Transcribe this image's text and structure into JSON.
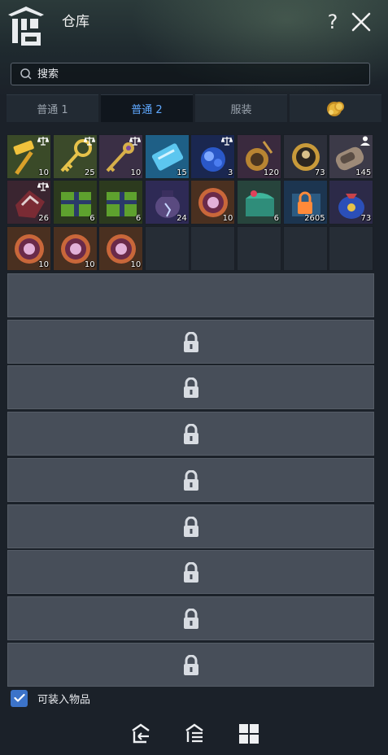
{
  "window": {
    "title": "仓库",
    "help_label": "?",
    "icons": {
      "logo": "warehouse-icon",
      "close": "close-icon"
    }
  },
  "search": {
    "placeholder": "搜索",
    "value": ""
  },
  "tabs": [
    {
      "label": "普通 1",
      "active": false
    },
    {
      "label": "普通 2",
      "active": true
    },
    {
      "label": "服装",
      "active": false
    },
    {
      "label": "",
      "icon": "gold-coin-icon",
      "active": false
    }
  ],
  "items": [
    {
      "name": "golden-hammer",
      "qty": "10",
      "scale": true
    },
    {
      "name": "golden-key",
      "qty": "25",
      "scale": true
    },
    {
      "name": "ornate-key",
      "qty": "10",
      "scale": true
    },
    {
      "name": "blue-scroll-ticket",
      "qty": "15",
      "scale": false
    },
    {
      "name": "blue-gem-cluster",
      "qty": "3",
      "scale": true
    },
    {
      "name": "bronze-amulet",
      "qty": "120",
      "scale": false
    },
    {
      "name": "gold-medal",
      "qty": "73",
      "scale": false
    },
    {
      "name": "pocket-device",
      "qty": "145",
      "scale": false,
      "person_badge": true
    },
    {
      "name": "red-crest-stone",
      "qty": "26",
      "scale": true
    },
    {
      "name": "green-gift-box",
      "qty": "6",
      "scale": false
    },
    {
      "name": "green-gift-box",
      "qty": "6",
      "scale": false
    },
    {
      "name": "purple-storm-jar",
      "qty": "24",
      "scale": false
    },
    {
      "name": "magic-seal-emblem",
      "qty": "10",
      "scale": false
    },
    {
      "name": "teal-treasure-chest",
      "qty": "6",
      "scale": false
    },
    {
      "name": "locked-chest",
      "qty": "2605",
      "scale": false
    },
    {
      "name": "blue-pouch",
      "qty": "73",
      "scale": false
    },
    {
      "name": "magic-seal-emblem",
      "qty": "10",
      "scale": false
    },
    {
      "name": "magic-seal-emblem",
      "qty": "10",
      "scale": false
    },
    {
      "name": "magic-seal-emblem",
      "qty": "10",
      "scale": false
    }
  ],
  "rows": [
    {
      "locked": false
    },
    {
      "locked": true
    },
    {
      "locked": true
    },
    {
      "locked": true
    },
    {
      "locked": true
    },
    {
      "locked": true
    },
    {
      "locked": true
    },
    {
      "locked": true
    },
    {
      "locked": true
    }
  ],
  "footer": {
    "checkbox_label": "可装入物品",
    "checkbox_checked": true,
    "buttons": [
      "deposit-icon",
      "sort-icon",
      "grid-view-icon"
    ]
  },
  "colors": {
    "active_tab": "#5fa8ff",
    "checkbox": "#3c73c9",
    "row_bar": "#474e59"
  }
}
